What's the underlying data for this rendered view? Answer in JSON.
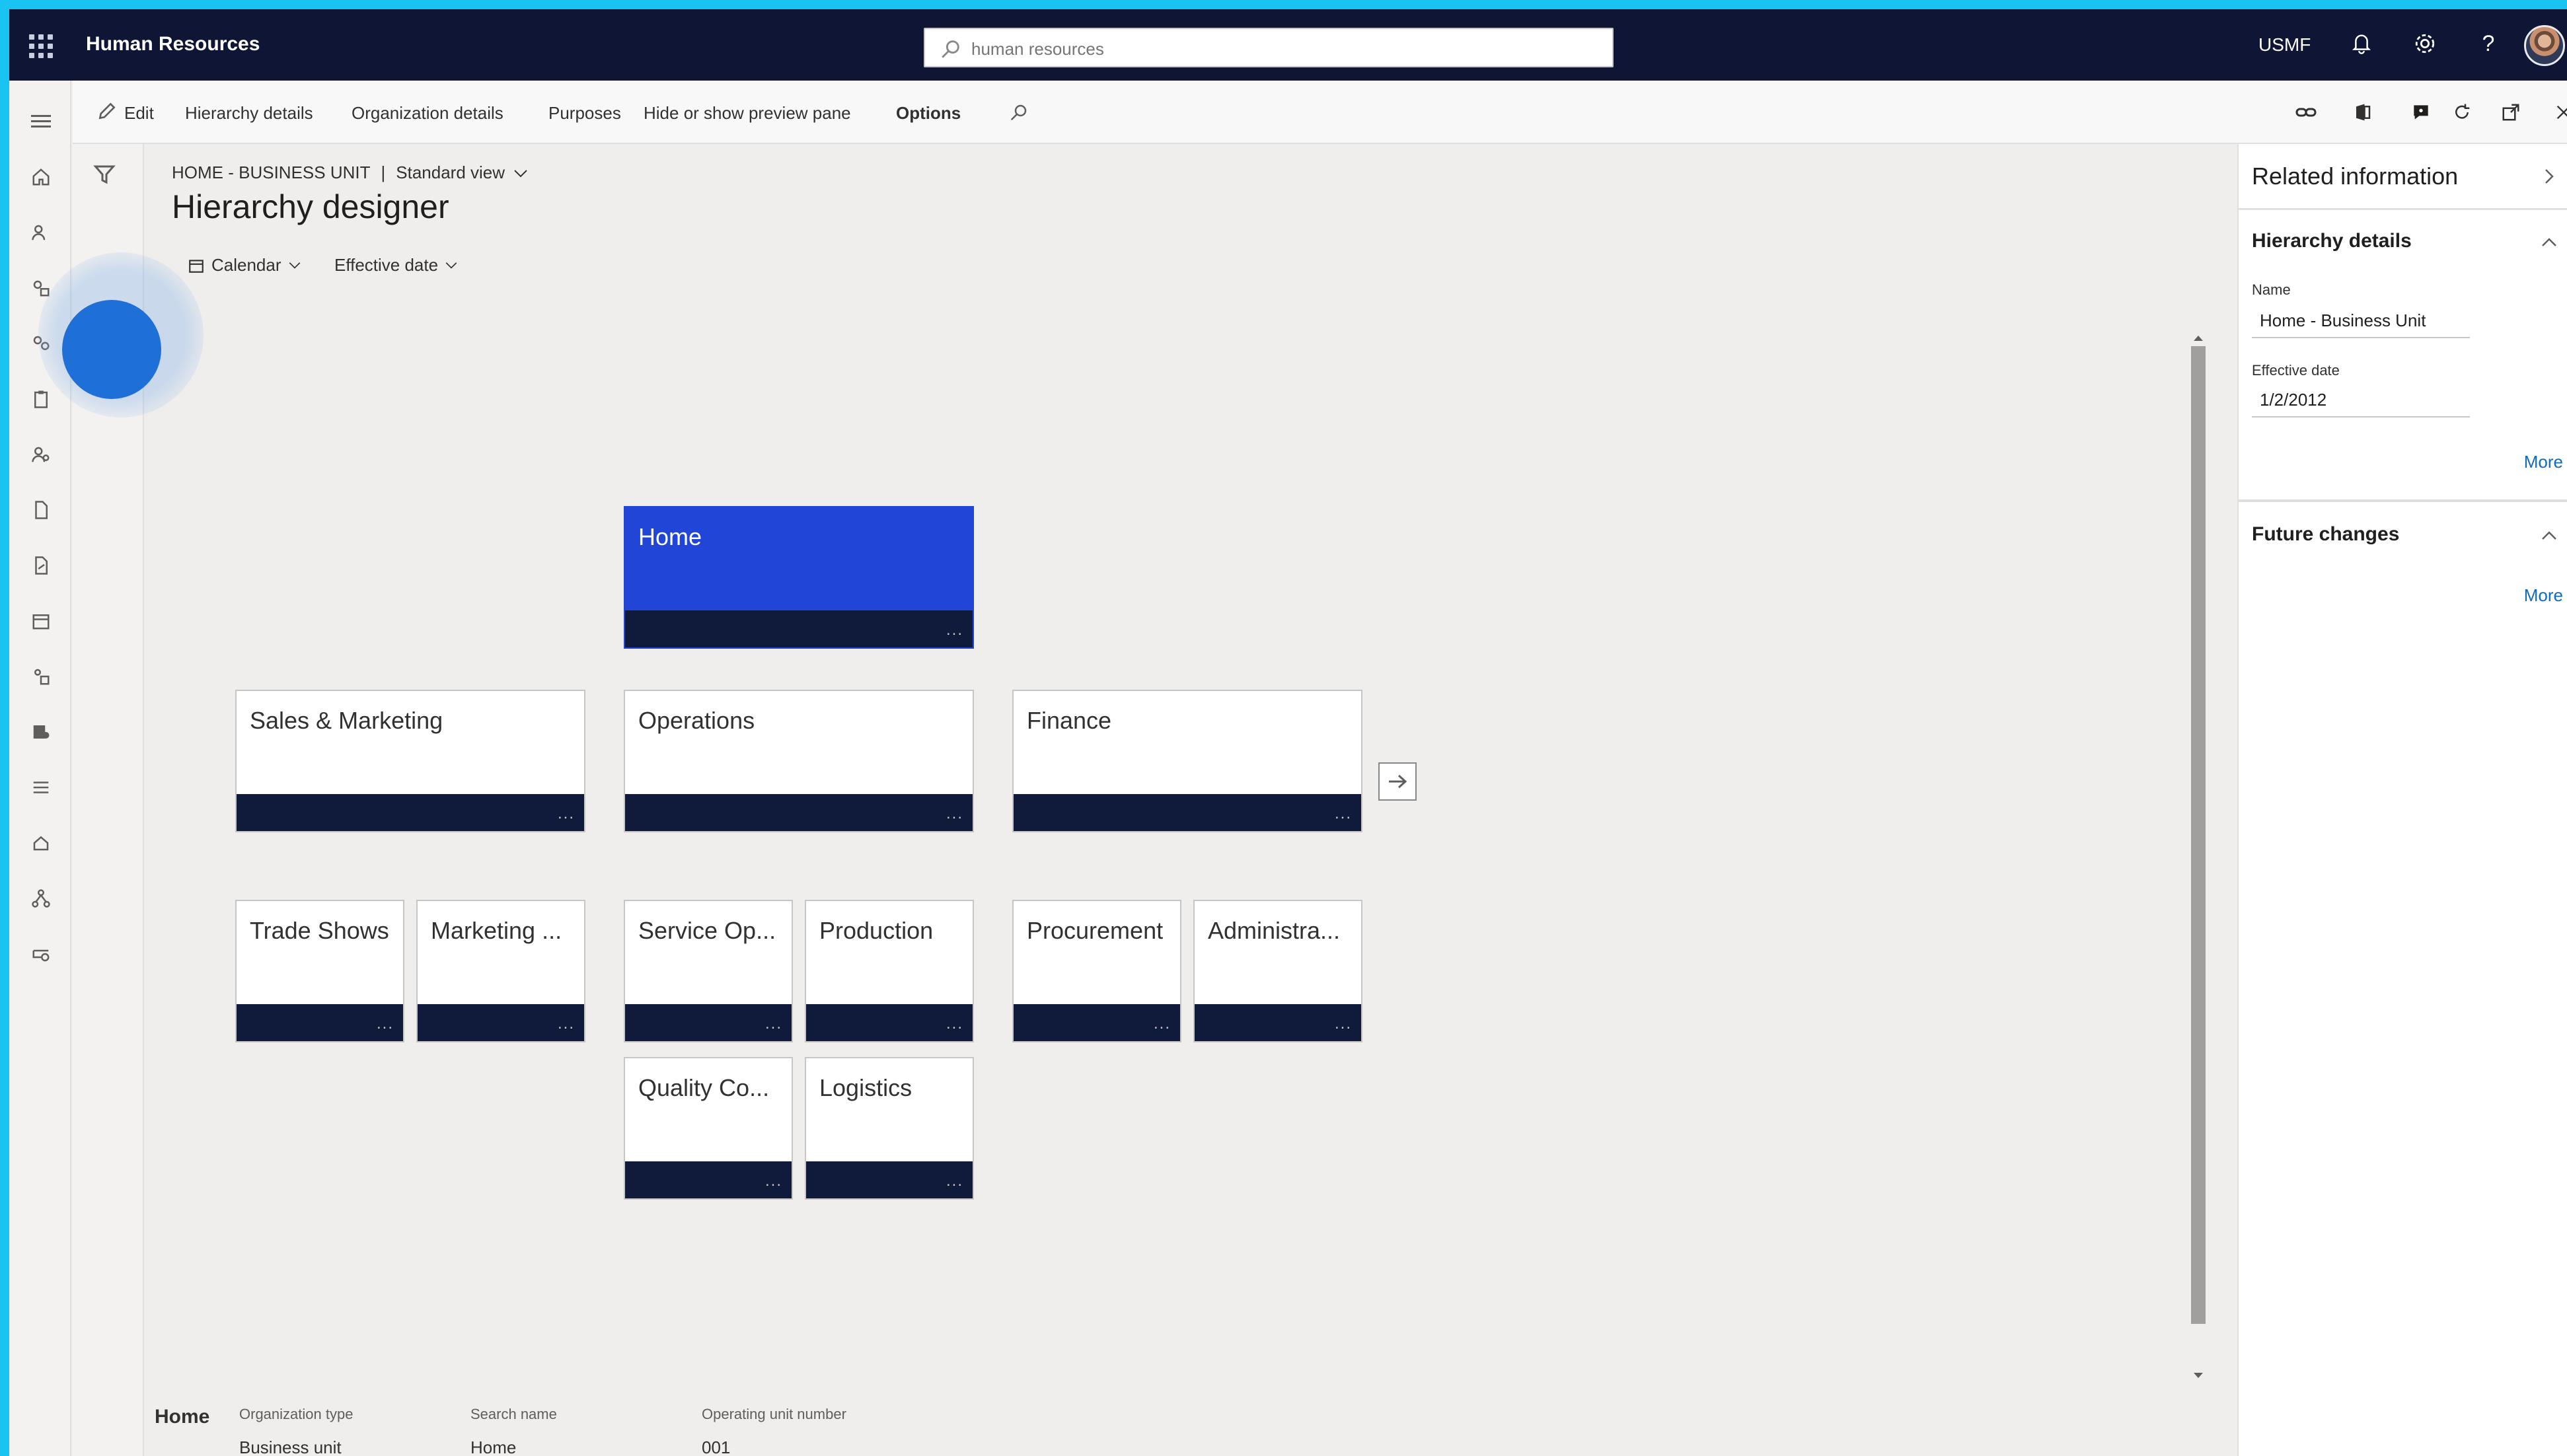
{
  "app": {
    "title": "Human Resources",
    "search": {
      "placeholder": "human resources"
    },
    "company": "USMF"
  },
  "action_pane": {
    "edit": "Edit",
    "hierarchy_details": "Hierarchy details",
    "organization_details": "Organization details",
    "purposes": "Purposes",
    "preview_pane": "Hide or show preview pane",
    "options": "Options"
  },
  "breadcrumb": {
    "path": "HOME - BUSINESS UNIT",
    "separator": "|",
    "view": "Standard view"
  },
  "page_title": "Hierarchy designer",
  "filters": {
    "calendar": "Calendar",
    "effective_date": "Effective date"
  },
  "hierarchy": {
    "root": {
      "label": "Home",
      "selected": true
    },
    "level1": [
      {
        "label": "Sales & Marketing"
      },
      {
        "label": "Operations"
      },
      {
        "label": "Finance"
      }
    ],
    "level2": [
      {
        "label": "Trade Shows"
      },
      {
        "label": "Marketing ..."
      },
      {
        "label": "Service Op..."
      },
      {
        "label": "Production"
      },
      {
        "label": "Procurement"
      },
      {
        "label": "Administra..."
      },
      {
        "label": "Quality Co..."
      },
      {
        "label": "Logistics"
      }
    ],
    "node_menu": "..."
  },
  "preview": {
    "name": "Home",
    "org_type_label": "Organization type",
    "org_type_value": "Business unit",
    "search_name_label": "Search name",
    "search_name_value": "Home",
    "op_unit_label": "Operating unit number",
    "op_unit_value": "001"
  },
  "related": {
    "title": "Related information",
    "hierarchy_details": {
      "title": "Hierarchy details",
      "name_label": "Name",
      "name_value": "Home - Business Unit",
      "effective_label": "Effective date",
      "effective_value": "1/2/2012",
      "more": "More"
    },
    "future_changes": {
      "title": "Future changes",
      "more": "More"
    }
  },
  "colors": {
    "topbar": "#0f1534",
    "selected_node": "#2145d6",
    "node_footer": "#101a3a",
    "frame": "#19c4f2",
    "link": "#0f6cbd"
  }
}
